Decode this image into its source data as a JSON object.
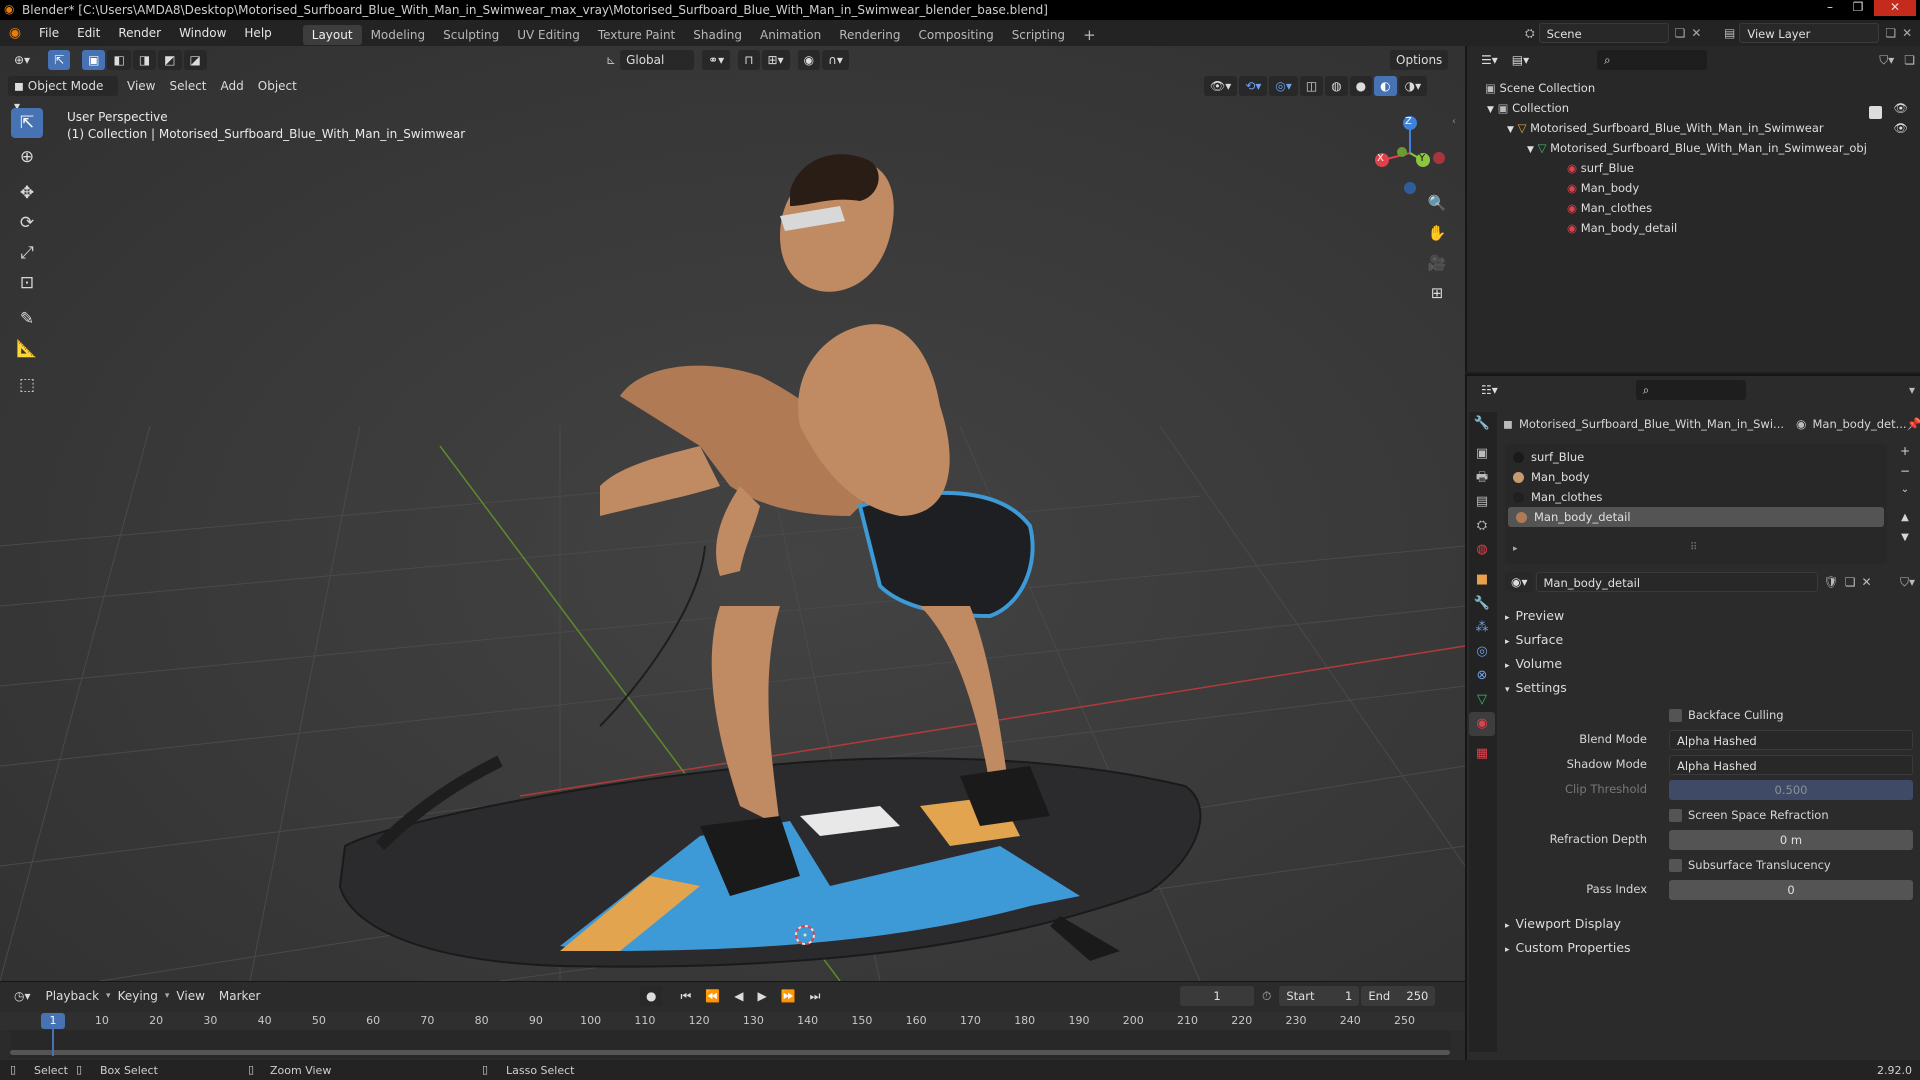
{
  "window": {
    "title": "Blender* [C:\\Users\\AMDA8\\Desktop\\Motorised_Surfboard_Blue_With_Man_in_Swimwear_max_vray\\Motorised_Surfboard_Blue_With_Man_in_Swimwear_blender_base.blend]",
    "minimize": "–",
    "maximize": "❐",
    "close": "✕"
  },
  "menus": [
    "File",
    "Edit",
    "Render",
    "Window",
    "Help"
  ],
  "workspaces": [
    "Layout",
    "Modeling",
    "Sculpting",
    "UV Editing",
    "Texture Paint",
    "Shading",
    "Animation",
    "Rendering",
    "Compositing",
    "Scripting"
  ],
  "add_workspace": "+",
  "scene": {
    "label": "Scene",
    "view_layer": "View Layer"
  },
  "viewport": {
    "transform_orientation": "Global",
    "options": "Options",
    "mode": "Object Mode",
    "menus": [
      "View",
      "Select",
      "Add",
      "Object"
    ],
    "overlay_title": "User Perspective",
    "overlay_collection": "(1) Collection | Motorised_Surfboard_Blue_With_Man_in_Swimwear",
    "gizmo": {
      "x": "X",
      "y": "Y",
      "z": "Z"
    }
  },
  "timeline": {
    "menus": [
      "Playback",
      "Keying",
      "View",
      "Marker"
    ],
    "current_frame": "1",
    "start_label": "Start",
    "start": "1",
    "end_label": "End",
    "end": "250",
    "ticks": [
      "1",
      "10",
      "20",
      "30",
      "40",
      "50",
      "60",
      "70",
      "80",
      "90",
      "100",
      "110",
      "120",
      "130",
      "140",
      "150",
      "160",
      "170",
      "180",
      "190",
      "200",
      "210",
      "220",
      "230",
      "240",
      "250"
    ]
  },
  "status": {
    "select": "Select",
    "box_select": "Box Select",
    "zoom_view": "Zoom View",
    "lasso_select": "Lasso Select",
    "version": "2.92.0"
  },
  "outliner": {
    "scene_collection": "Scene Collection",
    "collection": "Collection",
    "object": "Motorised_Surfboard_Blue_With_Man_in_Swimwear",
    "mesh": "Motorised_Surfboard_Blue_With_Man_in_Swimwear_obj",
    "materials": [
      "surf_Blue",
      "Man_body",
      "Man_clothes",
      "Man_body_detail"
    ]
  },
  "properties": {
    "object_name": "Motorised_Surfboard_Blue_With_Man_in_Swi...",
    "material_name_short": "Man_body_det...",
    "slots": [
      {
        "name": "surf_Blue",
        "color": "#1a1a1a"
      },
      {
        "name": "Man_body",
        "color": "#c89a70"
      },
      {
        "name": "Man_clothes",
        "color": "#202020"
      },
      {
        "name": "Man_body_detail",
        "color": "#b07a55"
      }
    ],
    "selected_slot": 3,
    "material_field": "Man_body_detail",
    "sections": {
      "preview": "Preview",
      "surface": "Surface",
      "volume": "Volume",
      "settings": "Settings",
      "viewport_display": "Viewport Display",
      "custom_properties": "Custom Properties"
    },
    "settings": {
      "backface_culling": "Backface Culling",
      "blend_mode_label": "Blend Mode",
      "blend_mode": "Alpha Hashed",
      "shadow_mode_label": "Shadow Mode",
      "shadow_mode": "Alpha Hashed",
      "clip_threshold_label": "Clip Threshold",
      "clip_threshold": "0.500",
      "ssr": "Screen Space Refraction",
      "refraction_depth_label": "Refraction Depth",
      "refraction_depth": "0 m",
      "sss": "Subsurface Translucency",
      "pass_index_label": "Pass Index",
      "pass_index": "0"
    }
  },
  "colors": {
    "accent": "#4772b3",
    "playhead": "#4772b3",
    "x_axis": "#e0414b",
    "y_axis": "#8cc63f",
    "z_axis": "#3f82d8"
  }
}
